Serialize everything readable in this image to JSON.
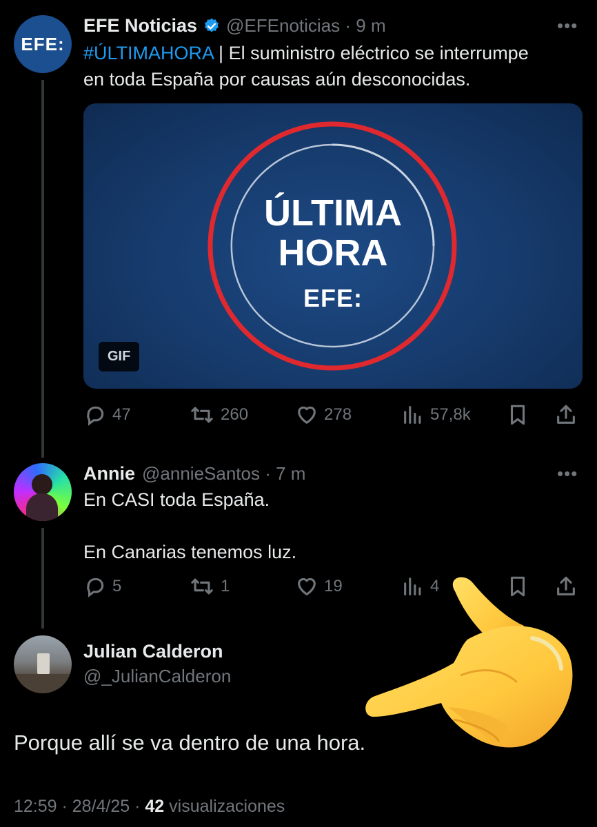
{
  "tweet_main": {
    "author_name": "EFE Noticias",
    "handle_time": "@EFEnoticias · 9 m",
    "avatar_text": "EFE:",
    "hashtag": "#ÚLTIMAHORA",
    "text_line1": " | El suministro eléctrico se interrumpe",
    "text_line2": "en toda España por causas aún desconocidas.",
    "media": {
      "line1": "ÚLTIMA",
      "line2": "HORA",
      "logo": "EFE:",
      "badge": "GIF"
    },
    "actions": {
      "replies": "47",
      "retweets": "260",
      "likes": "278",
      "views": "57,8k"
    }
  },
  "tweet_reply": {
    "author_name": "Annie",
    "handle_time": "@annieSantos · 7 m",
    "text_line1": "En CASI toda España.",
    "text_line2": "En Canarias tenemos luz.",
    "actions": {
      "replies": "5",
      "retweets": "1",
      "likes": "19",
      "views": "4"
    }
  },
  "tweet_focus": {
    "author_name": "Julian Calderon",
    "handle": "@_JulianCalderon",
    "text": "Porque allí se va dentro de una hora.",
    "timestamp": "12:59 · 28/4/25 · ",
    "views_count": "42",
    "views_label": " visualizaciones"
  },
  "colors": {
    "accent": "#1d9bf0",
    "efe_blue": "#1b4f8f",
    "media_blue": "#163a6b",
    "ring_red": "#e0292f"
  },
  "icons": [
    "verified-badge-icon",
    "more-icon",
    "reply-icon",
    "retweet-icon",
    "like-icon",
    "views-icon",
    "bookmark-icon",
    "share-icon",
    "pointing-hand-emoji"
  ]
}
